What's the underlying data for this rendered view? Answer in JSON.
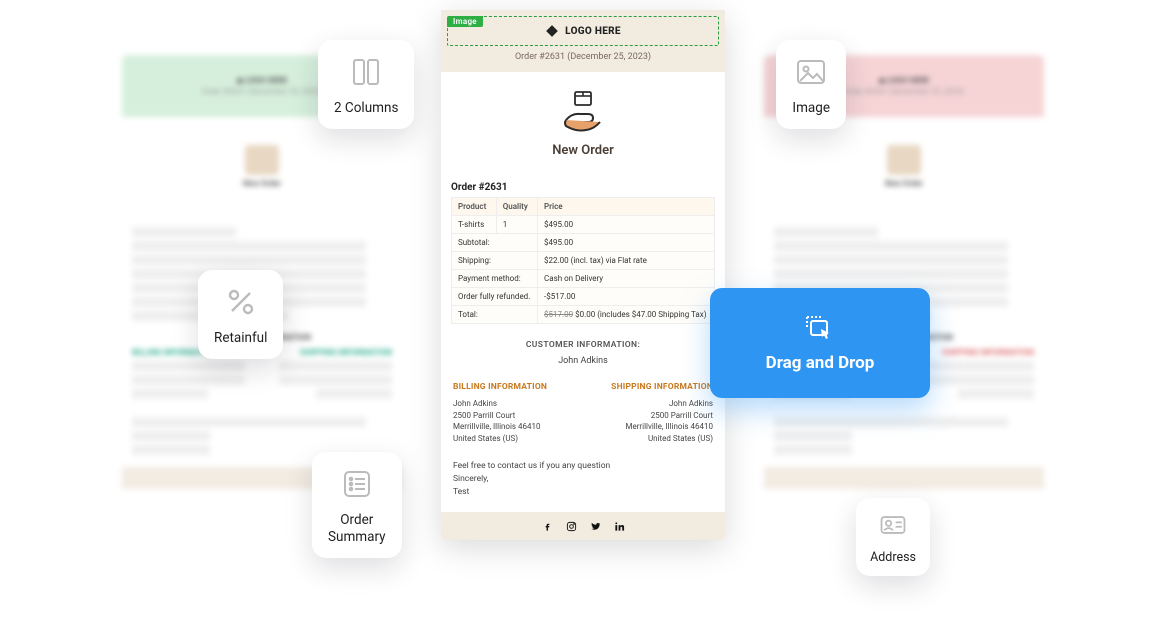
{
  "tiles": {
    "two_columns": "2 Columns",
    "image": "Image",
    "retainful": "Retainful",
    "order_summary": "Order\nSummary",
    "address": "Address"
  },
  "dnd": {
    "label": "Drag and Drop"
  },
  "center": {
    "selected_block_tag": "Image",
    "logo_text": "LOGO HERE",
    "subtitle": "Order #2631 (December 25, 2023)",
    "hero_title": "New Order",
    "order_heading": "Order #2631",
    "table": {
      "headers": [
        "Product",
        "Quality",
        "Price"
      ],
      "line": {
        "product": "T-shirts",
        "qty": "1",
        "price": "$495.00"
      },
      "rows": [
        {
          "label": "Subtotal:",
          "value": "$495.00"
        },
        {
          "label": "Shipping:",
          "value": "$22.00 (incl. tax) via Flat rate"
        },
        {
          "label": "Payment method:",
          "value": "Cash on Delivery"
        },
        {
          "label": "Order fully refunded.",
          "value": "-$517.00"
        }
      ],
      "total": {
        "label": "Total:",
        "strike": "$517.00",
        "value": "$0.00 (includes $47.00 Shipping Tax)"
      }
    },
    "customer": {
      "label": "CUSTOMER INFORMATION:",
      "name": "John Adkins"
    },
    "billing": {
      "title": "BILLING INFORMATION",
      "lines": [
        "John Adkins",
        "2500 Parrill Court",
        "Merrillville, Illinois 46410",
        "United States (US)"
      ]
    },
    "shipping": {
      "title": "SHIPPING INFORMATION",
      "lines": [
        "John Adkins",
        "2500 Parrill Court",
        "Merrillville, Illinois 46410",
        "United States (US)"
      ]
    },
    "footer_note": [
      "Feel free to contact us if you any question",
      "Sincerely,",
      "Test"
    ]
  },
  "side": {
    "logo": "LOGO HERE",
    "sub": "Order #2631 (December 25, 2023)",
    "hero": "New Order",
    "cust_label": "CUSTOMER INFORMATION",
    "bill": "BILLING INFORMATION",
    "ship": "SHIPPING INFORMATION"
  }
}
